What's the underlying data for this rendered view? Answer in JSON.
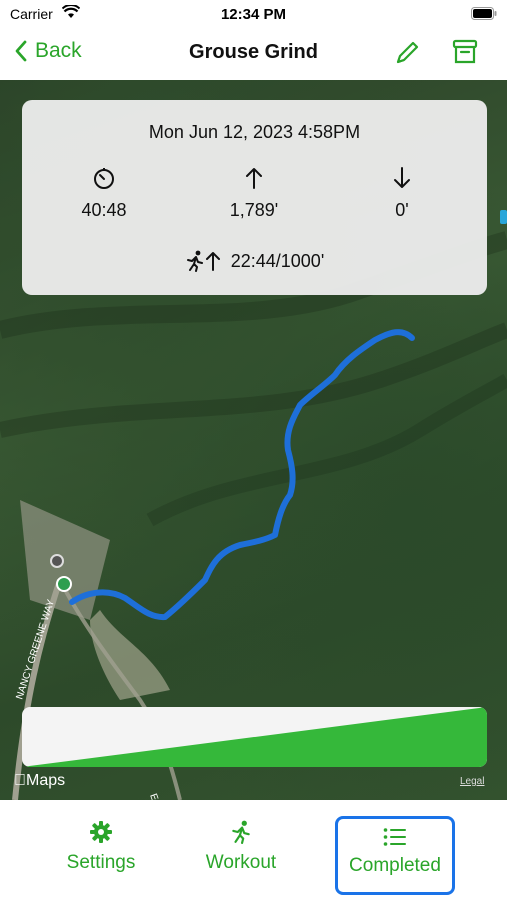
{
  "status": {
    "carrier": "Carrier",
    "time": "12:34 PM"
  },
  "nav": {
    "back_label": "Back",
    "title": "Grouse Grind",
    "edit_icon": "pencil-icon",
    "archive_icon": "archive-box-icon"
  },
  "card": {
    "date": "Mon Jun 12, 2023 4:58PM",
    "duration": "40:48",
    "ascent": "1,789'",
    "descent": "0'",
    "pace": "22:44/1000'"
  },
  "map": {
    "attribution": "Maps",
    "legal": "Legal",
    "road_label": "NANCY GREENE WAY",
    "road_label_2": "EA"
  },
  "tabs": [
    {
      "label": "Settings",
      "icon": "gear-icon"
    },
    {
      "label": "Workout",
      "icon": "running-icon"
    },
    {
      "label": "Completed",
      "icon": "list-icon",
      "selected": true
    }
  ],
  "colors": {
    "accent": "#2aa52a",
    "route": "#1e6fd9",
    "selected_border": "#1a73e8"
  }
}
